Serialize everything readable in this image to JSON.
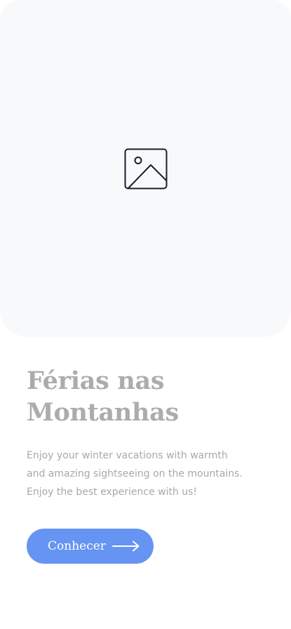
{
  "hero": {
    "image_icon": "image-placeholder-icon"
  },
  "content": {
    "title_line1": "Férias nas",
    "title_line2": "Montanhas",
    "desc_line1": "Enjoy your winter vacations with warmth",
    "desc_line2": "and amazing sightseeing on the mountains.",
    "desc_line3": "Enjoy the best experience with us!"
  },
  "cta": {
    "label": "Conhecer",
    "icon": "arrow-right-icon",
    "color": "#6694f2"
  },
  "colors": {
    "hero_bg": "#f8f9fb",
    "title": "#acacac",
    "text": "#a8a8a8"
  }
}
